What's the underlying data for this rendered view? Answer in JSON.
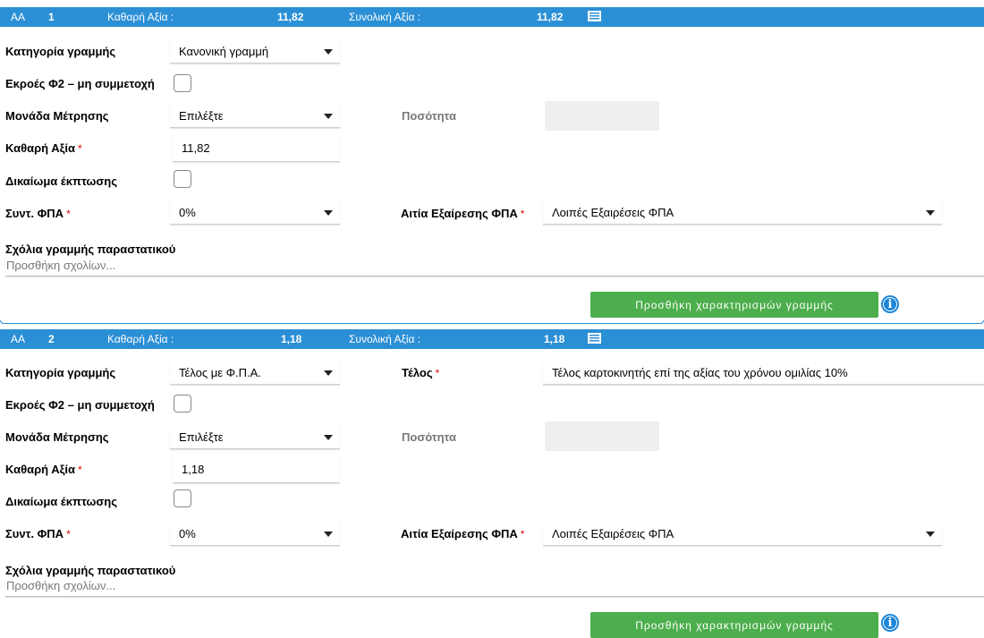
{
  "lines": [
    {
      "header": {
        "aa_label": "AA",
        "aa_number": "1",
        "net_label": "Καθαρή Αξία :",
        "net_value": "11,82",
        "total_label": "Συνολική Αξία :",
        "total_value": "11,82",
        "icon": "list-icon"
      },
      "category": {
        "label": "Κατηγορία γραμμής",
        "value": "Κανονική γραμμή"
      },
      "outflow": {
        "label": "Εκροές Φ2 – μη συμμετοχή"
      },
      "unit": {
        "label": "Μονάδα Μέτρησης",
        "value": "Επιλέξτε"
      },
      "quantity": {
        "label": "Ποσότητα",
        "value": ""
      },
      "net": {
        "label": "Καθαρή Αξία",
        "required": "*",
        "value": "11,82"
      },
      "deduction": {
        "label": "Δικαίωμα έκπτωσης"
      },
      "vat": {
        "label": "Συντ. ΦΠΑ",
        "required": "*",
        "value": "0%"
      },
      "exemption": {
        "label": "Αιτία Εξαίρεσης ΦΠΑ",
        "required": "*",
        "value": "Λοιπές Εξαιρέσεις ΦΠΑ"
      },
      "comments": {
        "label": "Σχόλια γραμμής παραστατικού",
        "placeholder": "Προσθήκη σχολίων..."
      },
      "add_button": "Προσθήκη χαρακτηρισμών γραμμής"
    },
    {
      "header": {
        "aa_label": "AA",
        "aa_number": "2",
        "net_label": "Καθαρή Αξία :",
        "net_value": "1,18",
        "total_label": "Συνολική Αξία :",
        "total_value": "1,18",
        "icon": "list-icon"
      },
      "category": {
        "label": "Κατηγορία γραμμής",
        "value": "Τέλος με Φ.Π.Α."
      },
      "fee": {
        "label": "Τέλος",
        "required": "*",
        "value": "Τέλος καρτοκινητής επί της αξίας του χρόνου ομιλίας 10%"
      },
      "outflow": {
        "label": "Εκροές Φ2 – μη συμμετοχή"
      },
      "unit": {
        "label": "Μονάδα Μέτρησης",
        "value": "Επιλέξτε"
      },
      "quantity": {
        "label": "Ποσότητα",
        "value": ""
      },
      "net": {
        "label": "Καθαρή Αξία",
        "required": "*",
        "value": "1,18"
      },
      "deduction": {
        "label": "Δικαίωμα έκπτωσης"
      },
      "vat": {
        "label": "Συντ. ΦΠΑ",
        "required": "*",
        "value": "0%"
      },
      "exemption": {
        "label": "Αιτία Εξαίρεσης ΦΠΑ",
        "required": "*",
        "value": "Λοιπές Εξαιρέσεις ΦΠΑ"
      },
      "comments": {
        "label": "Σχόλια γραμμής παραστατικού",
        "placeholder": "Προσθήκη σχολίων..."
      },
      "add_button": "Προσθήκη χαρακτηρισμών γραμμής"
    }
  ],
  "colors": {
    "header_blue": "#2b8fd6",
    "button_green": "#4cae4c",
    "required_red": "#dd0000",
    "info_blue": "#1e86d8"
  }
}
